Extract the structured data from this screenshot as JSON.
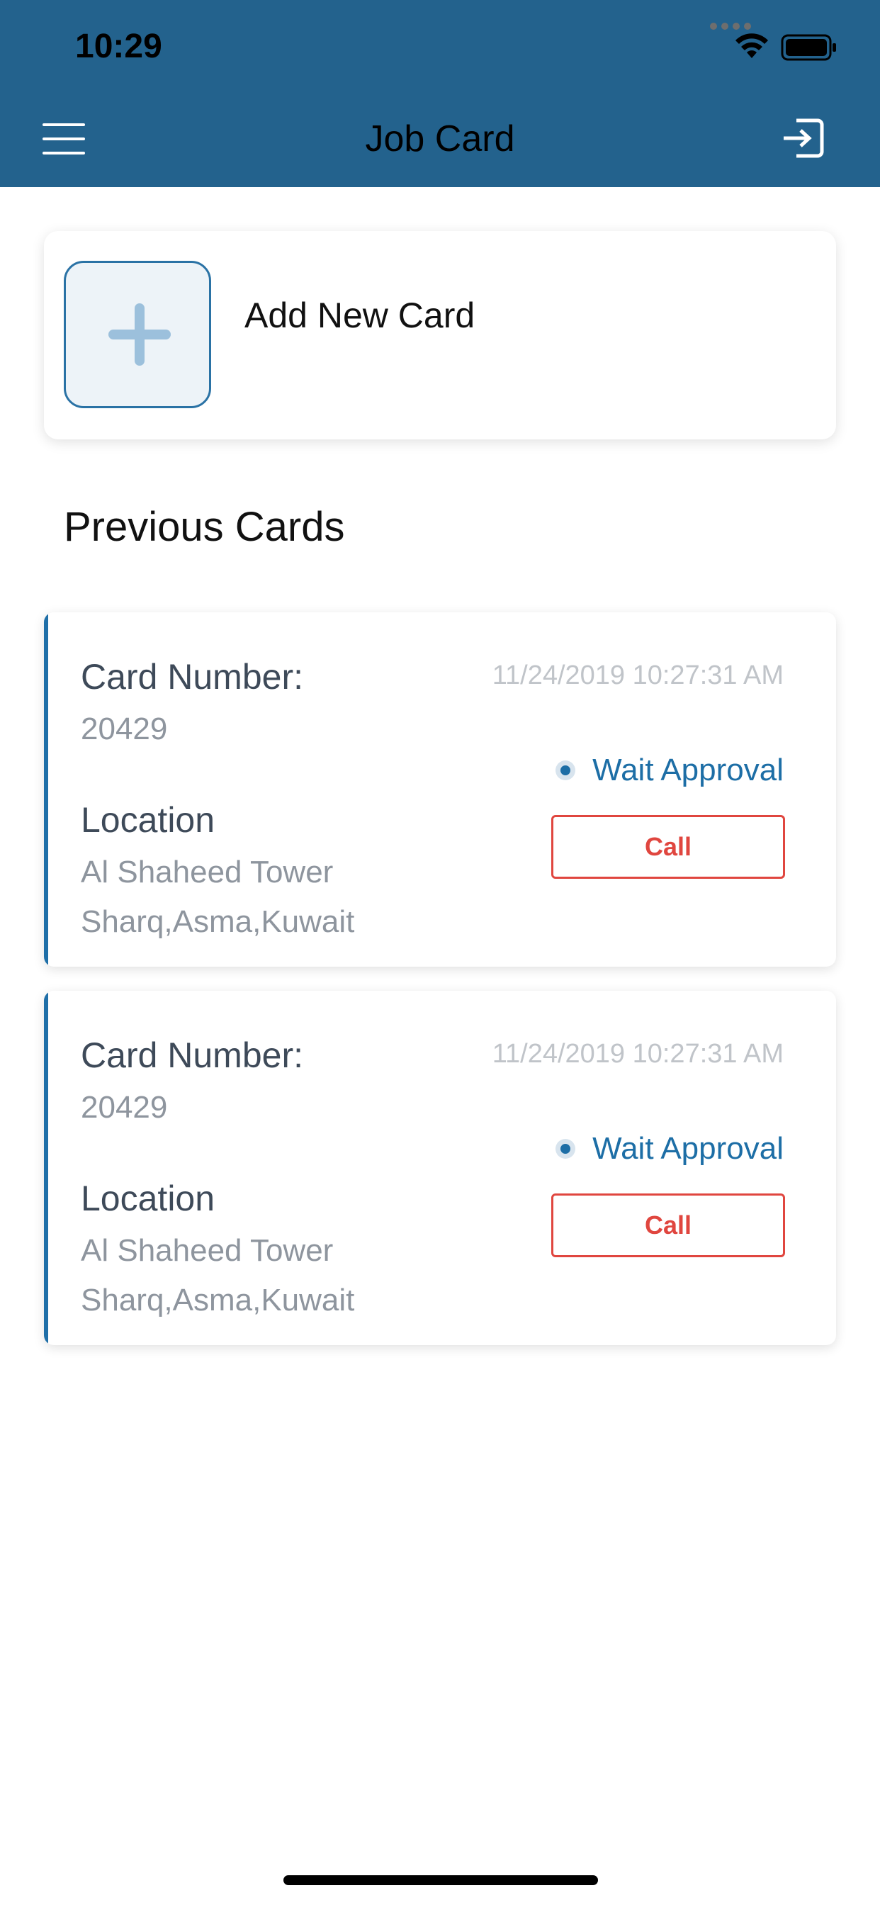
{
  "status_bar": {
    "time": "10:29"
  },
  "nav": {
    "title": "Job Card",
    "menu_icon": "hamburger-icon",
    "logout_icon": "logout-icon"
  },
  "add_card": {
    "label": "Add New Card",
    "icon": "plus-icon"
  },
  "previous_section": {
    "title": "Previous Cards"
  },
  "cards": [
    {
      "card_number_label": "Card Number:",
      "card_number": "20429",
      "location_label": "Location",
      "location_line1": "Al Shaheed Tower",
      "location_line2": "Sharq,Asma,Kuwait",
      "timestamp": "11/24/2019 10:27:31 AM",
      "status": "Wait Approval",
      "call_label": "Call"
    },
    {
      "card_number_label": "Card Number:",
      "card_number": "20429",
      "location_label": "Location",
      "location_line1": "Al Shaheed Tower",
      "location_line2": "Sharq,Asma,Kuwait",
      "timestamp": "11/24/2019 10:27:31 AM",
      "status": "Wait Approval",
      "call_label": "Call"
    }
  ],
  "colors": {
    "header_bg": "#23628d",
    "accent": "#1f6fa8",
    "call_red": "#e0463f",
    "status_blue": "#1d6ea6"
  }
}
